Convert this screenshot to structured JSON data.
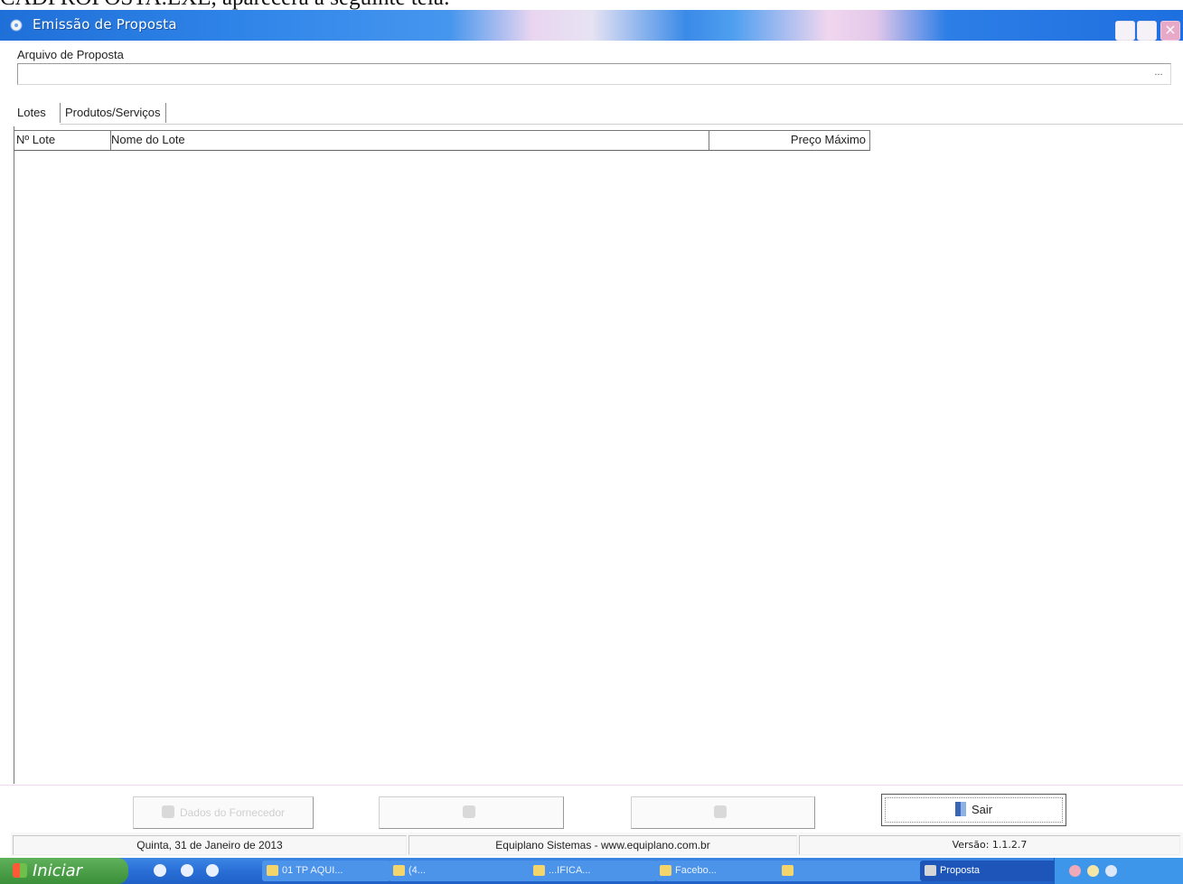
{
  "document_caption": "CADPROPOSTA.EXE, aparecerá a seguinte tela:",
  "window": {
    "title": "Emissão de Proposta"
  },
  "form": {
    "file_label": "Arquivo de Proposta",
    "file_value": "",
    "browse_label": "..."
  },
  "tabs": [
    {
      "label": "Lotes",
      "active": true
    },
    {
      "label": "Produtos/Serviços",
      "active": false
    }
  ],
  "grid": {
    "columns": [
      "Nº Lote",
      "Nome do Lote",
      "Preço Máximo"
    ],
    "rows": []
  },
  "buttons": {
    "supplier": "Dados do Fornecedor",
    "second": "",
    "third": "",
    "exit": "Sair"
  },
  "status": {
    "date": "Quinta, 31 de Janeiro de 2013",
    "company": "Equiplano Sistemas - www.equiplano.com.br",
    "version": "Versão: 1.1.2.7"
  },
  "taskbar": {
    "start_label": "Iniciar",
    "items": [
      "01 TP AQUI...",
      "(4...",
      "...IFICA...",
      "Facebo...",
      "",
      "Proposta"
    ],
    "active_item": "Proposta"
  },
  "colors": {
    "titlebar": "#2f84e8",
    "taskbar": "#2a6fd6",
    "start": "#3a8f38"
  }
}
